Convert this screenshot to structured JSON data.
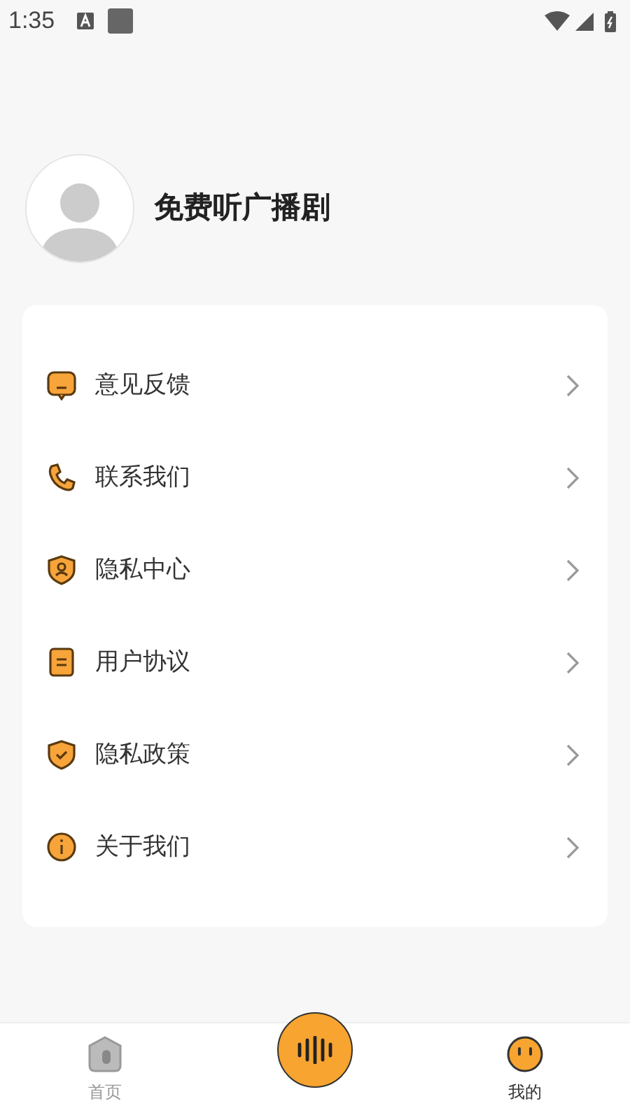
{
  "status_bar": {
    "time": "1:35"
  },
  "profile": {
    "name": "免费听广播剧"
  },
  "menu": [
    {
      "label": "意见反馈",
      "kind": "feedback"
    },
    {
      "label": "联系我们",
      "kind": "phone"
    },
    {
      "label": "隐私中心",
      "kind": "privacy-center"
    },
    {
      "label": "用户协议",
      "kind": "agreement"
    },
    {
      "label": "隐私政策",
      "kind": "policy"
    },
    {
      "label": "关于我们",
      "kind": "about"
    }
  ],
  "tab_bar": [
    {
      "label": "首页",
      "selected": false
    },
    {
      "kind": "center"
    },
    {
      "label": "我的",
      "selected": true
    }
  ]
}
